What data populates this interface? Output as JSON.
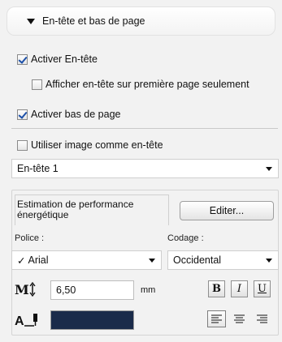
{
  "header": {
    "title": "En-tête et bas de page"
  },
  "options": {
    "enable_header": {
      "label": "Activer En-tête",
      "checked": true
    },
    "first_page_only": {
      "label": "Afficher en-tête sur première page seulement",
      "checked": false
    },
    "enable_footer": {
      "label": "Activer bas de page",
      "checked": true
    },
    "image_as_header": {
      "label": "Utiliser image comme en-tête",
      "checked": false
    }
  },
  "header_select": {
    "value": "En-tête 1"
  },
  "text_field": {
    "label": "Estimation de performance énergétique",
    "edit_button": "Editer..."
  },
  "font": {
    "label": "Police :",
    "value": "Arial",
    "check_glyph": "✓"
  },
  "encoding": {
    "label": "Codage :",
    "value": "Occidental"
  },
  "size": {
    "value": "6,50",
    "unit": "mm"
  },
  "style_buttons": {
    "bold": "B",
    "italic": "I",
    "underline": "U"
  },
  "text_color": "#1a2b4a",
  "alignment": {
    "selected": "left"
  }
}
